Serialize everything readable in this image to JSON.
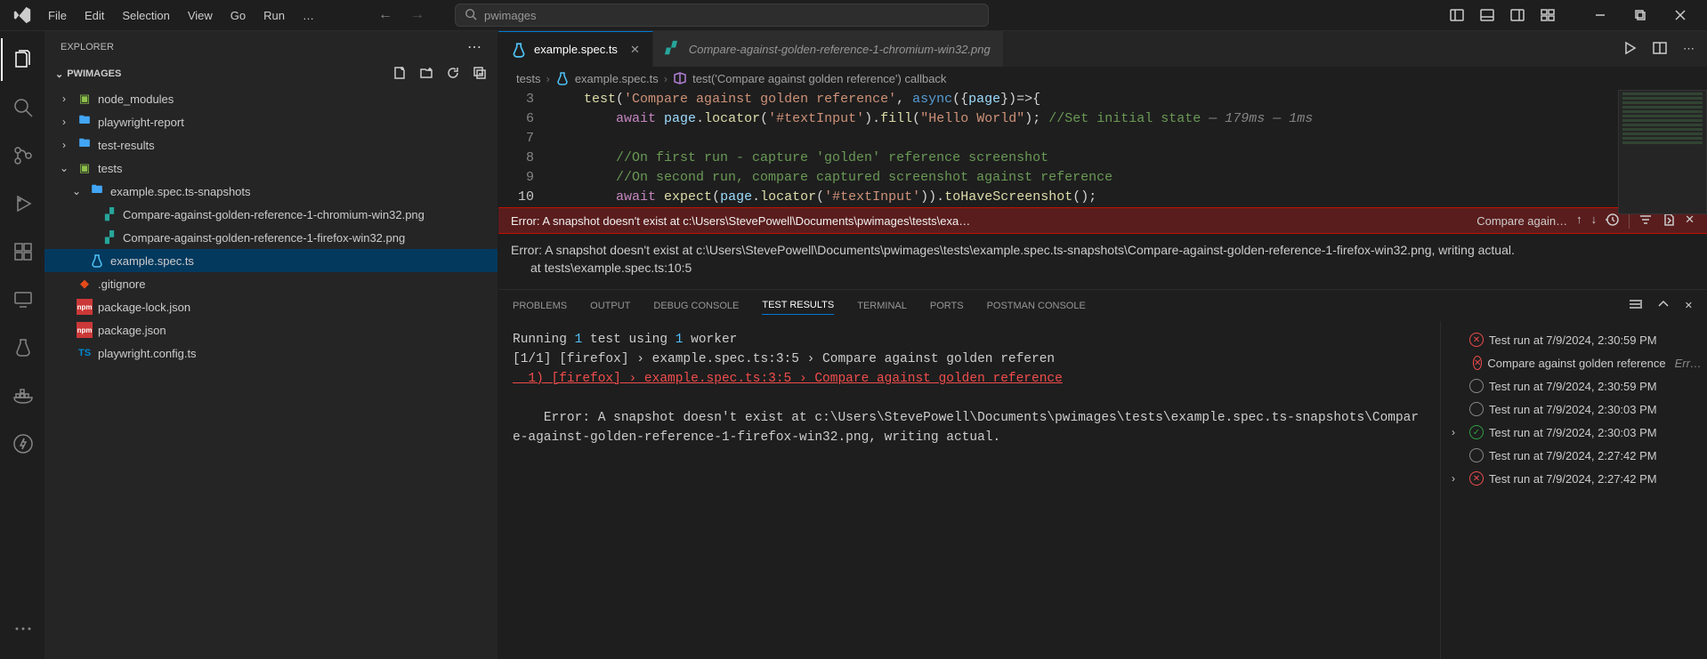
{
  "menu": {
    "items": [
      "File",
      "Edit",
      "Selection",
      "View",
      "Go",
      "Run",
      "…"
    ]
  },
  "search": {
    "placeholder": "pwimages"
  },
  "explorer": {
    "title": "EXPLORER",
    "section": "PWIMAGES",
    "tree": {
      "node_modules": "node_modules",
      "playwright_report": "playwright-report",
      "test_results": "test-results",
      "tests": "tests",
      "snapshots": "example.spec.ts-snapshots",
      "snap1": "Compare-against-golden-reference-1-chromium-win32.png",
      "snap2": "Compare-against-golden-reference-1-firefox-win32.png",
      "spec": "example.spec.ts",
      "gitignore": ".gitignore",
      "pkglock": "package-lock.json",
      "pkg": "package.json",
      "config": "playwright.config.ts"
    }
  },
  "tabs": {
    "t1": "example.spec.ts",
    "t2": "Compare-against-golden-reference-1-chromium-win32.png"
  },
  "breadcrumbs": {
    "c1": "tests",
    "c2": "example.spec.ts",
    "c3": "test('Compare against golden reference') callback"
  },
  "code": {
    "l3": "    test('Compare against golden reference', async({page})=>{",
    "l6": "        await page.locator('#textInput').fill(\"Hello World\"); //Set initial state",
    "l6_inlay": " — 179ms — 1ms",
    "l7": "",
    "l8": "        //On first run - capture 'golden' reference screenshot",
    "l9": "        //On second run, compare captured screenshot against reference",
    "l10": "        await expect(page.locator('#textInput')).toHaveScreenshot();",
    "lines": [
      "3",
      "6",
      "7",
      "8",
      "9",
      "10"
    ]
  },
  "error": {
    "header": "Error: A snapshot doesn't exist at c:\\Users\\StevePowell\\Documents\\pwimages\\tests\\exa…",
    "context": "Compare again…",
    "body": "Error: A snapshot doesn't exist at c:\\Users\\StevePowell\\Documents\\pwimages\\tests\\example.spec.ts-snapshots\\Compare-against-golden-reference-1-firefox-win32.png, writing actual.",
    "stack": "at tests\\example.spec.ts:10:5"
  },
  "panel": {
    "tabs": {
      "problems": "PROBLEMS",
      "output": "OUTPUT",
      "debug": "DEBUG CONSOLE",
      "results": "TEST RESULTS",
      "terminal": "TERMINAL",
      "ports": "PORTS",
      "postman": "POSTMAN CONSOLE"
    },
    "out": {
      "running_pre": "Running ",
      "running_n1": "1",
      "running_mid": " test using ",
      "running_n2": "1",
      "running_post": " worker",
      "line2": "[1/1] [firefox] › example.spec.ts:3:5 › Compare against golden referen",
      "line3": "  1) [firefox] › example.spec.ts:3:5 › Compare against golden reference",
      "err1": "    Error: A snapshot doesn't exist at c:\\Users\\StevePowell\\Documents\\pwimages\\tests\\example.spec.ts-snapshots\\Compare-against-golden-reference-1-firefox-win32.png, writing actual."
    },
    "runs": [
      {
        "status": "fail",
        "twistie": "",
        "label": "Test run at 7/9/2024, 2:30:59 PM"
      },
      {
        "status": "fail",
        "twistie": "",
        "label": "Compare against golden reference",
        "err": "Err…",
        "indent": 1
      },
      {
        "status": "ring",
        "twistie": "",
        "label": "Test run at 7/9/2024, 2:30:59 PM"
      },
      {
        "status": "ring",
        "twistie": "",
        "label": "Test run at 7/9/2024, 2:30:03 PM"
      },
      {
        "status": "pass",
        "twistie": "›",
        "label": "Test run at 7/9/2024, 2:30:03 PM"
      },
      {
        "status": "ring",
        "twistie": "",
        "label": "Test run at 7/9/2024, 2:27:42 PM"
      },
      {
        "status": "fail",
        "twistie": "›",
        "label": "Test run at 7/9/2024, 2:27:42 PM"
      }
    ]
  }
}
